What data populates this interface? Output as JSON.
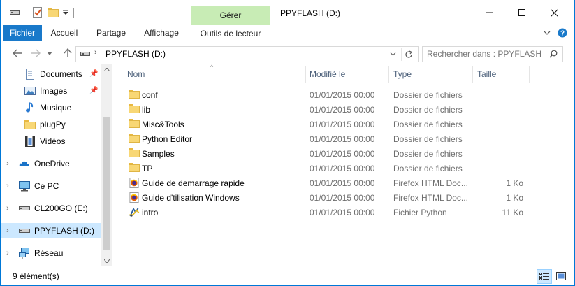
{
  "ribbon_contextual": {
    "label": "Gérer"
  },
  "window": {
    "title": "PPYFLASH (D:)"
  },
  "tabs": [
    {
      "label": "Fichier"
    },
    {
      "label": "Accueil"
    },
    {
      "label": "Partage"
    },
    {
      "label": "Affichage"
    },
    {
      "label": "Outils de lecteur"
    }
  ],
  "address": {
    "path": "PPYFLASH (D:)"
  },
  "search": {
    "placeholder": "Rechercher dans : PPYFLASH ..."
  },
  "navpane": {
    "items": [
      {
        "label": "Documents",
        "icon": "documents-icon",
        "pinned": true
      },
      {
        "label": "Images",
        "icon": "pictures-icon",
        "pinned": true
      },
      {
        "label": "Musique",
        "icon": "music-icon",
        "pinned": false
      },
      {
        "label": "plugPy",
        "icon": "folder-icon",
        "pinned": false
      },
      {
        "label": "Vidéos",
        "icon": "videos-icon",
        "pinned": false
      },
      {
        "label": "OneDrive",
        "icon": "onedrive-icon"
      },
      {
        "label": "Ce PC",
        "icon": "this-pc-icon"
      },
      {
        "label": "CL200GO (E:)",
        "icon": "drive-icon"
      },
      {
        "label": "PPYFLASH (D:)",
        "icon": "drive-icon",
        "selected": true
      },
      {
        "label": "Réseau",
        "icon": "network-icon"
      }
    ]
  },
  "columns": {
    "name": "Nom",
    "date": "Modifié le",
    "type": "Type",
    "size": "Taille"
  },
  "files": [
    {
      "name": "conf",
      "date": "01/01/2015 00:00",
      "type": "Dossier de fichiers",
      "size": "",
      "icon": "folder-icon"
    },
    {
      "name": "lib",
      "date": "01/01/2015 00:00",
      "type": "Dossier de fichiers",
      "size": "",
      "icon": "folder-icon"
    },
    {
      "name": "Misc&Tools",
      "date": "01/01/2015 00:00",
      "type": "Dossier de fichiers",
      "size": "",
      "icon": "folder-icon"
    },
    {
      "name": "Python Editor",
      "date": "01/01/2015 00:00",
      "type": "Dossier de fichiers",
      "size": "",
      "icon": "folder-icon"
    },
    {
      "name": "Samples",
      "date": "01/01/2015 00:00",
      "type": "Dossier de fichiers",
      "size": "",
      "icon": "folder-icon"
    },
    {
      "name": "TP",
      "date": "01/01/2015 00:00",
      "type": "Dossier de fichiers",
      "size": "",
      "icon": "folder-icon"
    },
    {
      "name": "Guide de demarrage rapide",
      "date": "01/01/2015 00:00",
      "type": "Firefox HTML Doc...",
      "size": "1 Ko",
      "icon": "firefox-html-icon"
    },
    {
      "name": "Guide d'tilisation Windows",
      "date": "01/01/2015 00:00",
      "type": "Firefox HTML Doc...",
      "size": "1 Ko",
      "icon": "firefox-html-icon"
    },
    {
      "name": "intro",
      "date": "01/01/2015 00:00",
      "type": "Fichier Python",
      "size": "11 Ko",
      "icon": "python-file-icon"
    }
  ],
  "status": {
    "count": "9 élément(s)"
  },
  "colors": {
    "accent": "#0078d7",
    "fichier_tab": "#1979ca",
    "manage_tab": "#c8ecb5",
    "selection": "#cce8ff"
  }
}
